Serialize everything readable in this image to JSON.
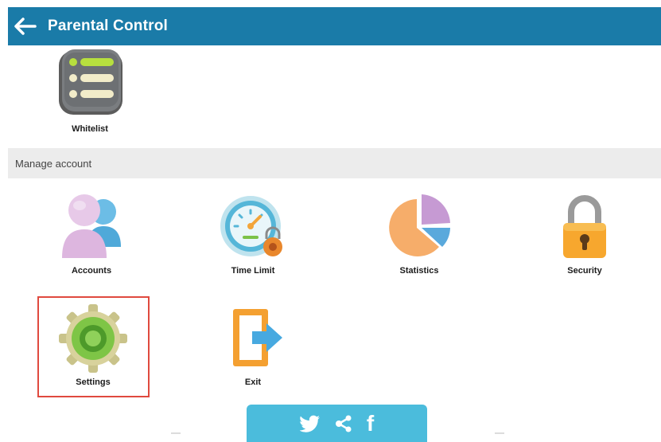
{
  "header": {
    "back_icon": "arrow-left-icon",
    "title": "Parental Control",
    "color": "#1a7ba8"
  },
  "top_items": [
    {
      "label": "Whitelist",
      "icon": "list-icon"
    }
  ],
  "section": {
    "title": "Manage account"
  },
  "manage_items": [
    {
      "label": "Accounts",
      "icon": "users-icon"
    },
    {
      "label": "Time Limit",
      "icon": "speedometer-lock-icon"
    },
    {
      "label": "Statistics",
      "icon": "pie-chart-icon"
    },
    {
      "label": "Security",
      "icon": "padlock-icon"
    },
    {
      "label": "Settings",
      "icon": "gear-icon",
      "selected": true
    },
    {
      "label": "Exit",
      "icon": "exit-door-icon"
    }
  ],
  "share_bar": {
    "color": "#4bbcdc",
    "icons": [
      "twitter-icon",
      "share-icon",
      "facebook-icon"
    ],
    "facebook_glyph": "f"
  },
  "colors": {
    "highlight": "#e04a3f",
    "section_bg": "#ececec"
  }
}
